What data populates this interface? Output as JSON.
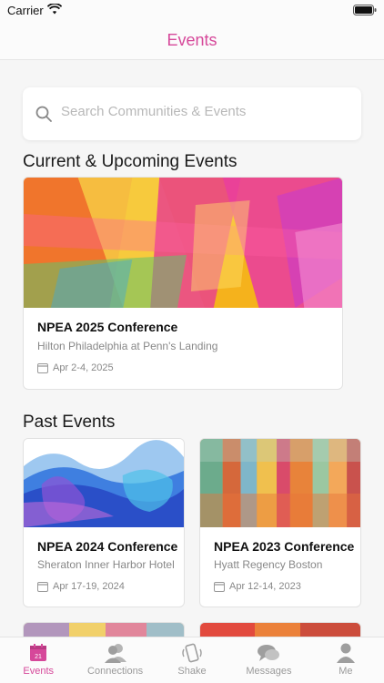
{
  "status_bar": {
    "carrier": "Carrier"
  },
  "nav": {
    "title": "Events"
  },
  "search": {
    "placeholder": "Search Communities & Events"
  },
  "sections": {
    "upcoming_title": "Current & Upcoming Events",
    "past_title": "Past Events"
  },
  "upcoming_events": [
    {
      "title": "NPEA 2025 Conference",
      "venue": "Hilton Philadelphia at Penn's Landing",
      "date": "Apr 2-4, 2025"
    }
  ],
  "past_events": [
    {
      "title": "NPEA 2024 Conference",
      "venue": "Sheraton Inner Harbor Hotel",
      "date": "Apr 17-19, 2024"
    },
    {
      "title": "NPEA 2023 Conference",
      "venue": "Hyatt Regency Boston",
      "date": "Apr 12-14, 2023"
    }
  ],
  "tabs": [
    {
      "label": "Events",
      "icon": "calendar-icon",
      "badge": "21",
      "active": true
    },
    {
      "label": "Connections",
      "icon": "people-icon",
      "active": false
    },
    {
      "label": "Shake",
      "icon": "phone-shake-icon",
      "active": false
    },
    {
      "label": "Messages",
      "icon": "chat-bubbles-icon",
      "active": false
    },
    {
      "label": "Me",
      "icon": "person-icon",
      "active": false
    }
  ],
  "colors": {
    "accent": "#d6489a",
    "inactive_tab": "#9a9a9a"
  }
}
